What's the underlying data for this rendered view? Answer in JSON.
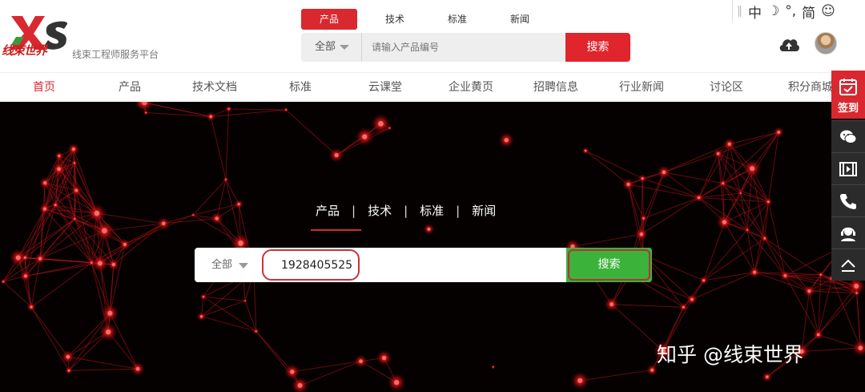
{
  "header": {
    "logo_word": "线束世界",
    "tagline": "线束工程师服务平台",
    "tabs": [
      "产品",
      "技术",
      "标准",
      "新闻"
    ],
    "search": {
      "select": "全部",
      "placeholder": "请输入产品编号",
      "button": "搜索"
    }
  },
  "ime": {
    "lang": "中",
    "punct": "°,",
    "charset": "简"
  },
  "nav": [
    "首页",
    "产品",
    "技术文档",
    "标准",
    "云课堂",
    "企业黄页",
    "招聘信息",
    "行业新闻",
    "讨论区",
    "积分商城"
  ],
  "hero": {
    "tabs": [
      "产品",
      "技术",
      "标准",
      "新闻"
    ],
    "search": {
      "select": "全部",
      "value": "1928405525",
      "button": "搜索"
    }
  },
  "sidebar": {
    "sign": "签到",
    "icons": [
      "wechat-icon",
      "video-icon",
      "phone-icon",
      "support-agent-icon",
      "back-to-top-icon"
    ]
  },
  "watermark": "知乎 @线束世界",
  "colors": {
    "brand_red": "#d9282f",
    "search_green": "#3bb33a",
    "hero_bg": "#050101",
    "sidebar_dark": "#2b2b2b"
  }
}
